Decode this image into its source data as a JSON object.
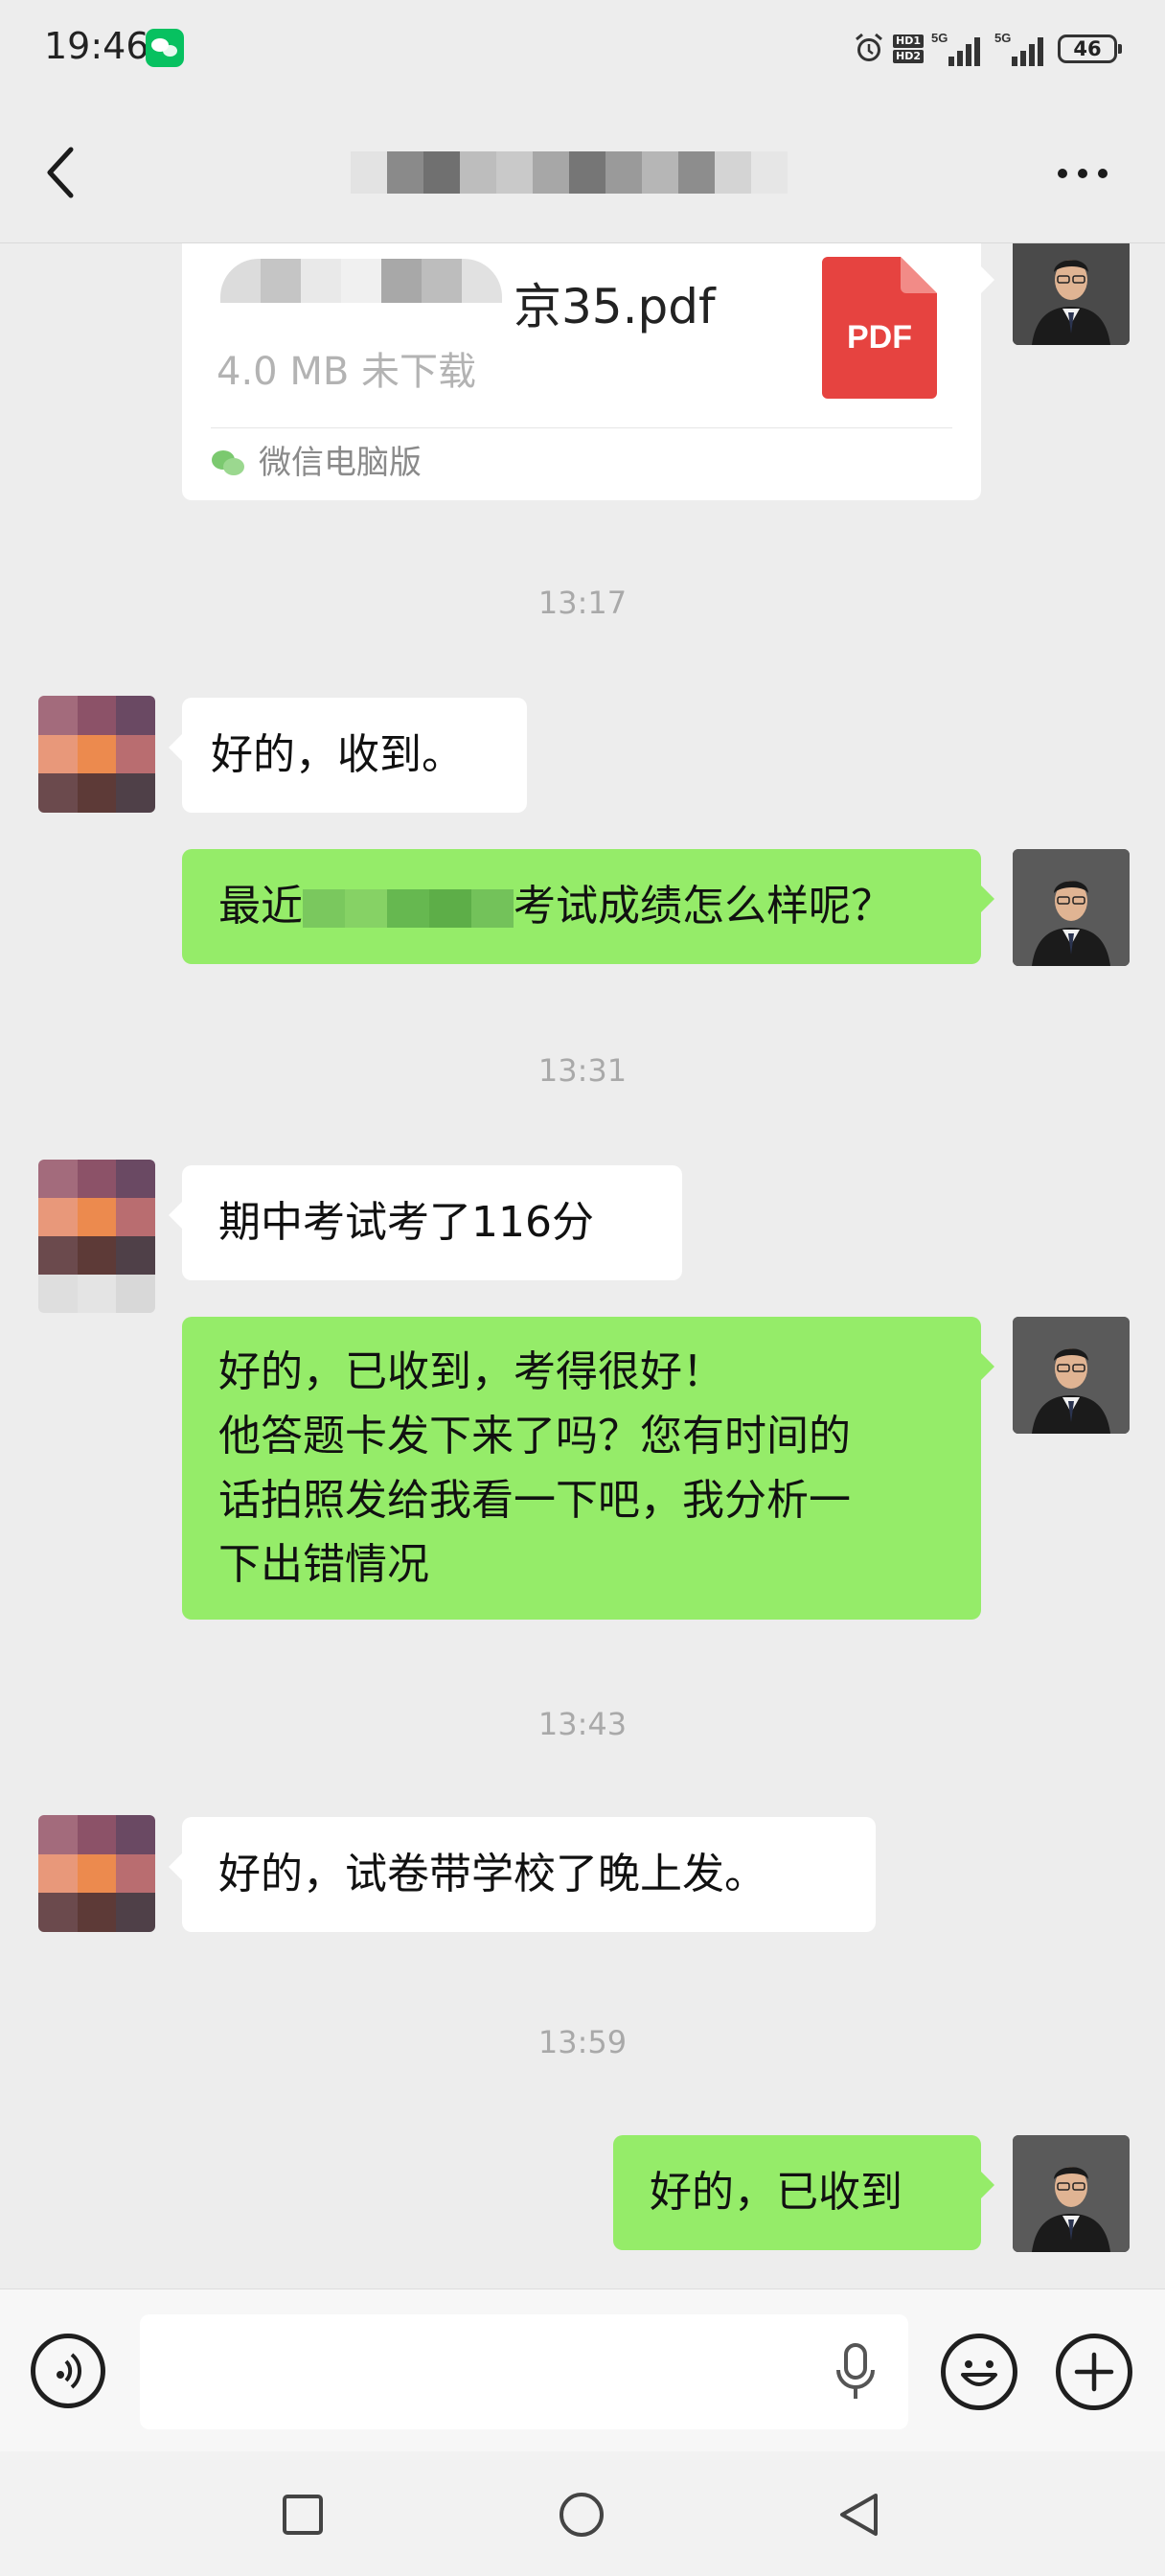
{
  "status_bar": {
    "time": "19:46",
    "battery": "46",
    "network_1": "5G",
    "network_2": "5G",
    "hd_1": "HD1",
    "hd_2": "HD2"
  },
  "header": {
    "title": "",
    "title_blurred": true
  },
  "messages": {
    "file": {
      "name": "京35.pdf",
      "size": "4.0 MB 未下载",
      "icon_label": "PDF",
      "source": "微信电脑版"
    },
    "time_1": "13:17",
    "msg_1": "好的，收到。",
    "msg_2_start": "最近",
    "msg_2_end": "考试成绩怎么样呢？",
    "time_2": "13:31",
    "msg_3": "期中考试考了116分",
    "msg_4_line_1": "好的，已收到，考得很好！",
    "msg_4_line_2": "他答题卡发下来了吗？您有时间的",
    "msg_4_line_3": "话拍照发给我看一下吧，我分析一",
    "msg_4_line_4": "下出错情况",
    "time_3": "13:43",
    "msg_5": "好的，试卷带学校了晚上发。",
    "time_4": "13:59",
    "msg_6": "好的，已收到"
  },
  "input": {
    "placeholder": ""
  },
  "colors": {
    "background": "#ededed",
    "outgoing_bubble": "#95ec69",
    "incoming_bubble": "#ffffff",
    "wechat_green": "#07c160",
    "pdf_red": "#e64340"
  },
  "icons": [
    "back-icon",
    "more-icon",
    "voice-icon",
    "microphone-icon",
    "emoji-icon",
    "plus-icon",
    "pdf-icon",
    "wechat-icon",
    "alarm-icon",
    "signal-icon",
    "battery-icon"
  ]
}
